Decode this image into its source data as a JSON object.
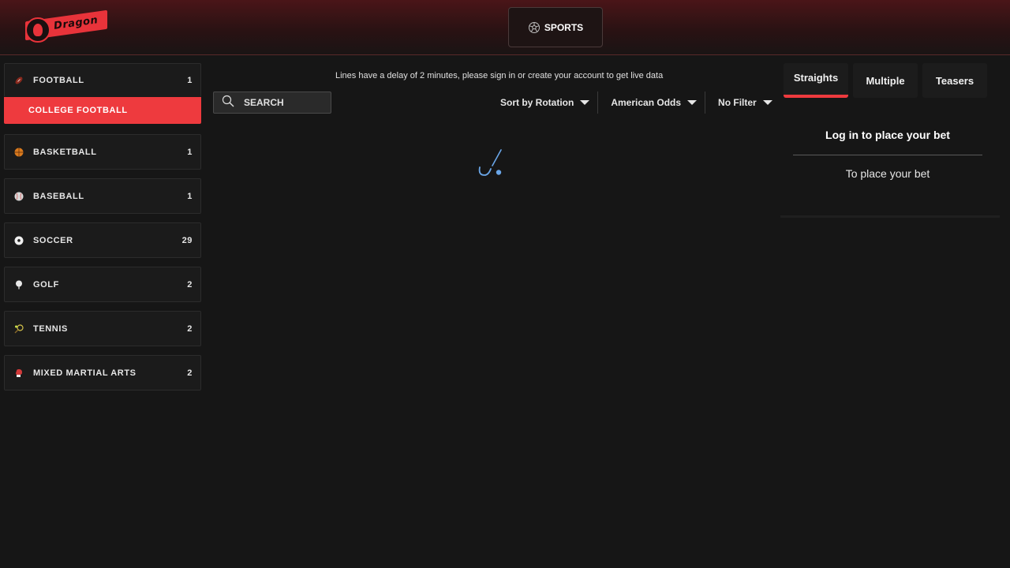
{
  "header": {
    "logo_text": "Dragon",
    "sports_tab_label": "SPORTS"
  },
  "sidebar": {
    "items": [
      {
        "label": "FOOTBALL",
        "count": "1",
        "icon": "football-icon",
        "subitems": [
          {
            "label": "COLLEGE FOOTBALL",
            "active": true
          }
        ]
      },
      {
        "label": "BASKETBALL",
        "count": "1",
        "icon": "basketball-icon"
      },
      {
        "label": "BASEBALL",
        "count": "1",
        "icon": "baseball-icon"
      },
      {
        "label": "SOCCER",
        "count": "29",
        "icon": "soccer-ball-icon"
      },
      {
        "label": "GOLF",
        "count": "2",
        "icon": "golf-ball-icon"
      },
      {
        "label": "TENNIS",
        "count": "2",
        "icon": "tennis-racket-icon"
      },
      {
        "label": "MIXED MARTIAL ARTS",
        "count": "2",
        "icon": "boxing-glove-icon"
      }
    ]
  },
  "main": {
    "notice": "Lines have a delay of 2 minutes, please sign in or create your account to get live data",
    "search": {
      "placeholder": "SEARCH"
    },
    "filters": {
      "sort": "Sort by Rotation",
      "odds": "American Odds",
      "filter": "No Filter"
    }
  },
  "betslip": {
    "tabs": [
      {
        "label": "Straights",
        "active": true
      },
      {
        "label": "Multiple",
        "active": false
      },
      {
        "label": "Teasers",
        "active": false
      }
    ],
    "login_title": "Log in to place your bet",
    "login_sub": "To place your bet"
  },
  "colors": {
    "accent": "#ee3a3e",
    "background": "#161616",
    "header_top": "#4a1518",
    "spinner": "#6aa6e8"
  }
}
